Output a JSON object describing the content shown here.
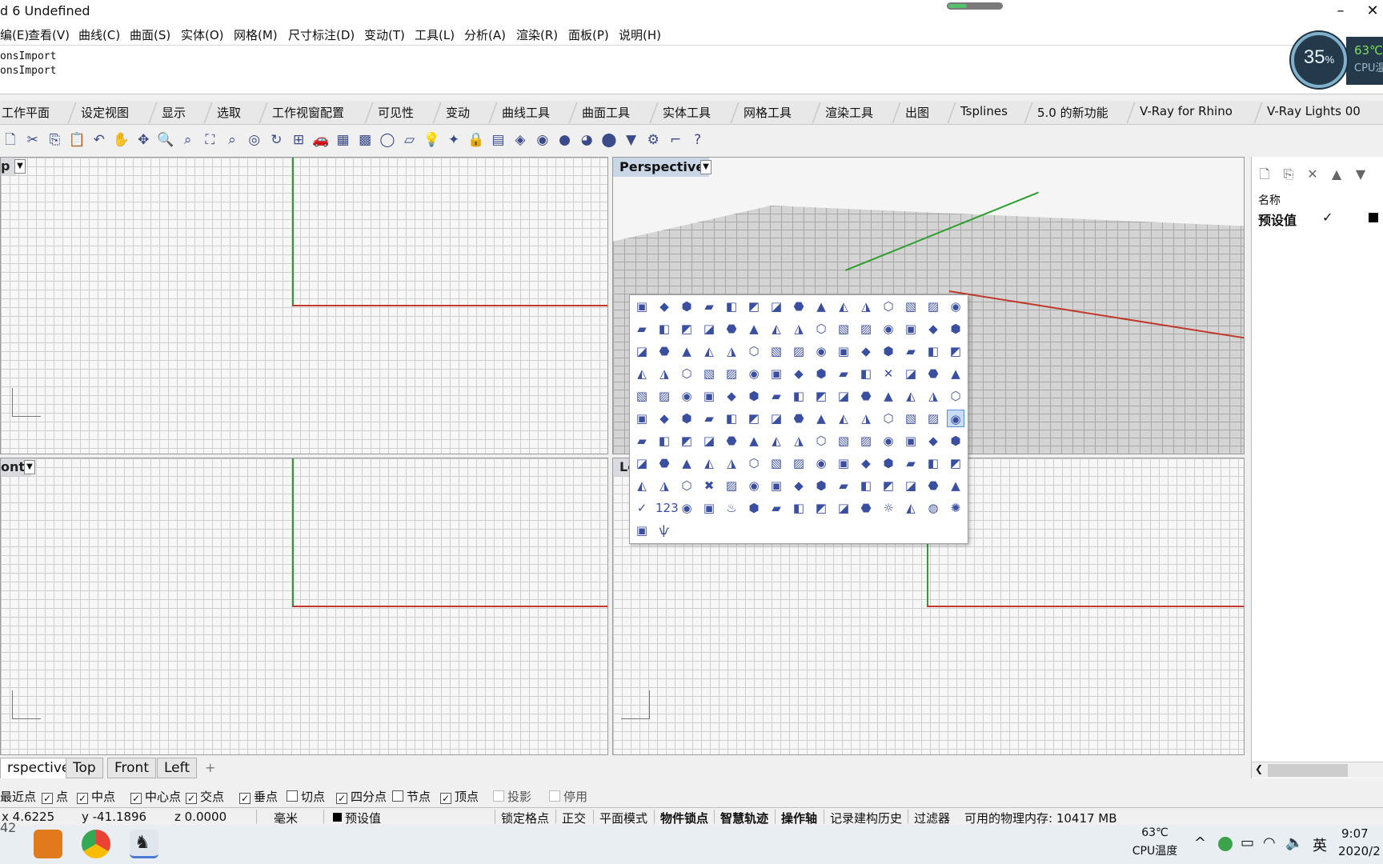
{
  "window": {
    "title": "d 6 Undefined",
    "minimize": "–",
    "close": "✕",
    "progress": 0.35
  },
  "menu": [
    "编(E)",
    "查看(V)",
    "曲线(C)",
    "曲面(S)",
    "实体(O)",
    "网格(M)",
    "尺寸标注(D)",
    "变动(T)",
    "工具(L)",
    "分析(A)",
    "渲染(R)",
    "面板(P)",
    "说明(H)"
  ],
  "command_history": [
    "onsImport",
    "onsImport"
  ],
  "cpu_widget": {
    "percent": "35",
    "percent_sign": "%",
    "temp": "63℃",
    "label": "CPU温"
  },
  "toolbar_tabs": [
    "工作平面",
    "设定视图",
    "显示",
    "选取",
    "工作视窗配置",
    "可见性",
    "变动",
    "曲线工具",
    "曲面工具",
    "实体工具",
    "网格工具",
    "渲染工具",
    "出图",
    "Tsplines",
    "5.0 的新功能",
    "V-Ray for Rhino",
    "V-Ray Lights 00"
  ],
  "toolbar_icons": [
    "new-doc",
    "cut",
    "copy",
    "paste",
    "undo",
    "pan",
    "move",
    "zoom",
    "zoom-window",
    "zoom-extents",
    "zoom-selected",
    "zoom-target",
    "rotate-view",
    "four-view",
    "car",
    "mesh",
    "render-mesh",
    "circle",
    "plane",
    "light",
    "point-light",
    "lock",
    "layer",
    "paint-bucket",
    "color",
    "sphere-shade",
    "sphere-render",
    "sphere-blue",
    "spotlight",
    "gear",
    "dimension",
    "help"
  ],
  "viewports": {
    "top": {
      "label": "p",
      "arrow": "▼"
    },
    "perspective": {
      "label": "Perspective",
      "arrow": "▼"
    },
    "front": {
      "label": "ont",
      "arrow": "▼"
    },
    "left": {
      "label": "Le"
    }
  },
  "popup_icons": [
    [
      "grid",
      "box",
      "undo",
      "cube",
      "color-wheel",
      "shield",
      "zoom",
      "lamp",
      "bulbs",
      "lock",
      "layer-copy",
      "layer-split",
      "link",
      "group",
      "edit"
    ],
    [
      "box-blue",
      "mirror",
      "diamond",
      "array",
      "dots-circle",
      "dots-curve",
      "nodes",
      "column",
      "pipe",
      "stairs",
      "wall",
      "wall2",
      "sheet",
      "engine",
      "eye"
    ],
    [
      "mesh-grid",
      "grid2",
      "hat",
      "scatter",
      "plane-grid",
      "cross-dots",
      "square-dots",
      "square",
      "curve",
      "spiral",
      "arrow-up",
      "wave",
      "s-curve",
      "zigzag",
      "arc"
    ],
    [
      "dash-line",
      "clock",
      "knot",
      "paren",
      "figure",
      "line-cut",
      "polyline",
      "curve2",
      "curve3",
      "corner",
      "connect",
      "x-mark",
      "hook",
      "disc",
      "cylinder"
    ],
    [
      "tile",
      "cube2",
      "diamond2",
      "flag",
      "stripes",
      "hex",
      "box3",
      "crate",
      "sphere-grey",
      "flower",
      "wing",
      "arrow-box",
      "cube-tile",
      "arrows",
      "film"
    ],
    [
      "pencil",
      "vase",
      "cup",
      "cylinder2",
      "shell",
      "cone",
      "knob",
      "tree",
      "panel",
      "fold",
      "corner2",
      "boot",
      "sail",
      "twist",
      "loft-active"
    ],
    [
      "blade",
      "twist2",
      "twist3",
      "twist4",
      "cone2",
      "layers",
      "person",
      "person2",
      "stand",
      "step",
      "center-box",
      "drum",
      "frame",
      "sphere-pair",
      "sphere-cut"
    ],
    [
      "circle-ring",
      "link-ring",
      "box-open",
      "book",
      "stack",
      "cube5",
      "molecule",
      "bridge",
      "arrow-cube",
      "arrow-cube2",
      "star-cube",
      "arrow-out",
      "slide",
      "octagon",
      "frame2"
    ],
    [
      "box-split",
      "box-frame",
      "box-gap",
      "x-box",
      "slab",
      "stairs2",
      "wave2",
      "bracket",
      "curve4",
      "alpha",
      "curl",
      "rainbow",
      "g2",
      "disk",
      "color-cube"
    ],
    [
      "check",
      "counter",
      "cube-sparkle",
      "dial",
      "teapot",
      "hand",
      "photo",
      "photo2",
      "sphere-grid",
      "cap",
      "tag",
      "sun",
      "half-disk",
      "globe",
      "sun-ray"
    ],
    [
      "cube-dashed",
      "grass"
    ]
  ],
  "popup_glyphs": {
    "check": "✓",
    "counter": "123",
    "sun": "☼",
    "sun-ray": "✺",
    "globe": "◍",
    "teapot": "♨",
    "grass": "ѱ",
    "x-mark": "✕",
    "x-box": "✖"
  },
  "viewport_tabs": [
    "rspective",
    "Top",
    "Front",
    "Left"
  ],
  "viewport_tabs_add": "+",
  "osnaps": [
    {
      "label": "最近点",
      "checked": false,
      "partial": true
    },
    {
      "label": "点",
      "checked": true
    },
    {
      "label": "中点",
      "checked": true
    },
    {
      "label": "中心点",
      "checked": true
    },
    {
      "label": "交点",
      "checked": true
    },
    {
      "label": "垂点",
      "checked": true
    },
    {
      "label": "切点",
      "checked": false
    },
    {
      "label": "四分点",
      "checked": true
    },
    {
      "label": "节点",
      "checked": false
    },
    {
      "label": "顶点",
      "checked": true
    },
    {
      "label": "投影",
      "checked": false,
      "disabled": true
    },
    {
      "label": "停用",
      "checked": false,
      "disabled": true
    }
  ],
  "status": {
    "x": "x 4.6225",
    "y": "y -41.1896",
    "z": "z 0.0000",
    "unit": "毫米",
    "layer": "预设值",
    "modes": [
      "锁定格点",
      "正交",
      "平面模式",
      "物件锁点",
      "智慧轨迹",
      "操作轴",
      "记录建构历史",
      "过滤器"
    ],
    "memory": "可用的物理内存: 10417 MB"
  },
  "taskbar": {
    "left_num": "42",
    "temp": "63℃",
    "temp_label": "CPU温度",
    "lang": "英",
    "time": "9:07",
    "date": "2020/2"
  },
  "layer_panel": {
    "header": "名称",
    "row": "预设值",
    "check": "✓"
  },
  "colors": {
    "axis_x": "#c0392b",
    "axis_y": "#2e9e2e",
    "accent": "#3b4fa0"
  }
}
